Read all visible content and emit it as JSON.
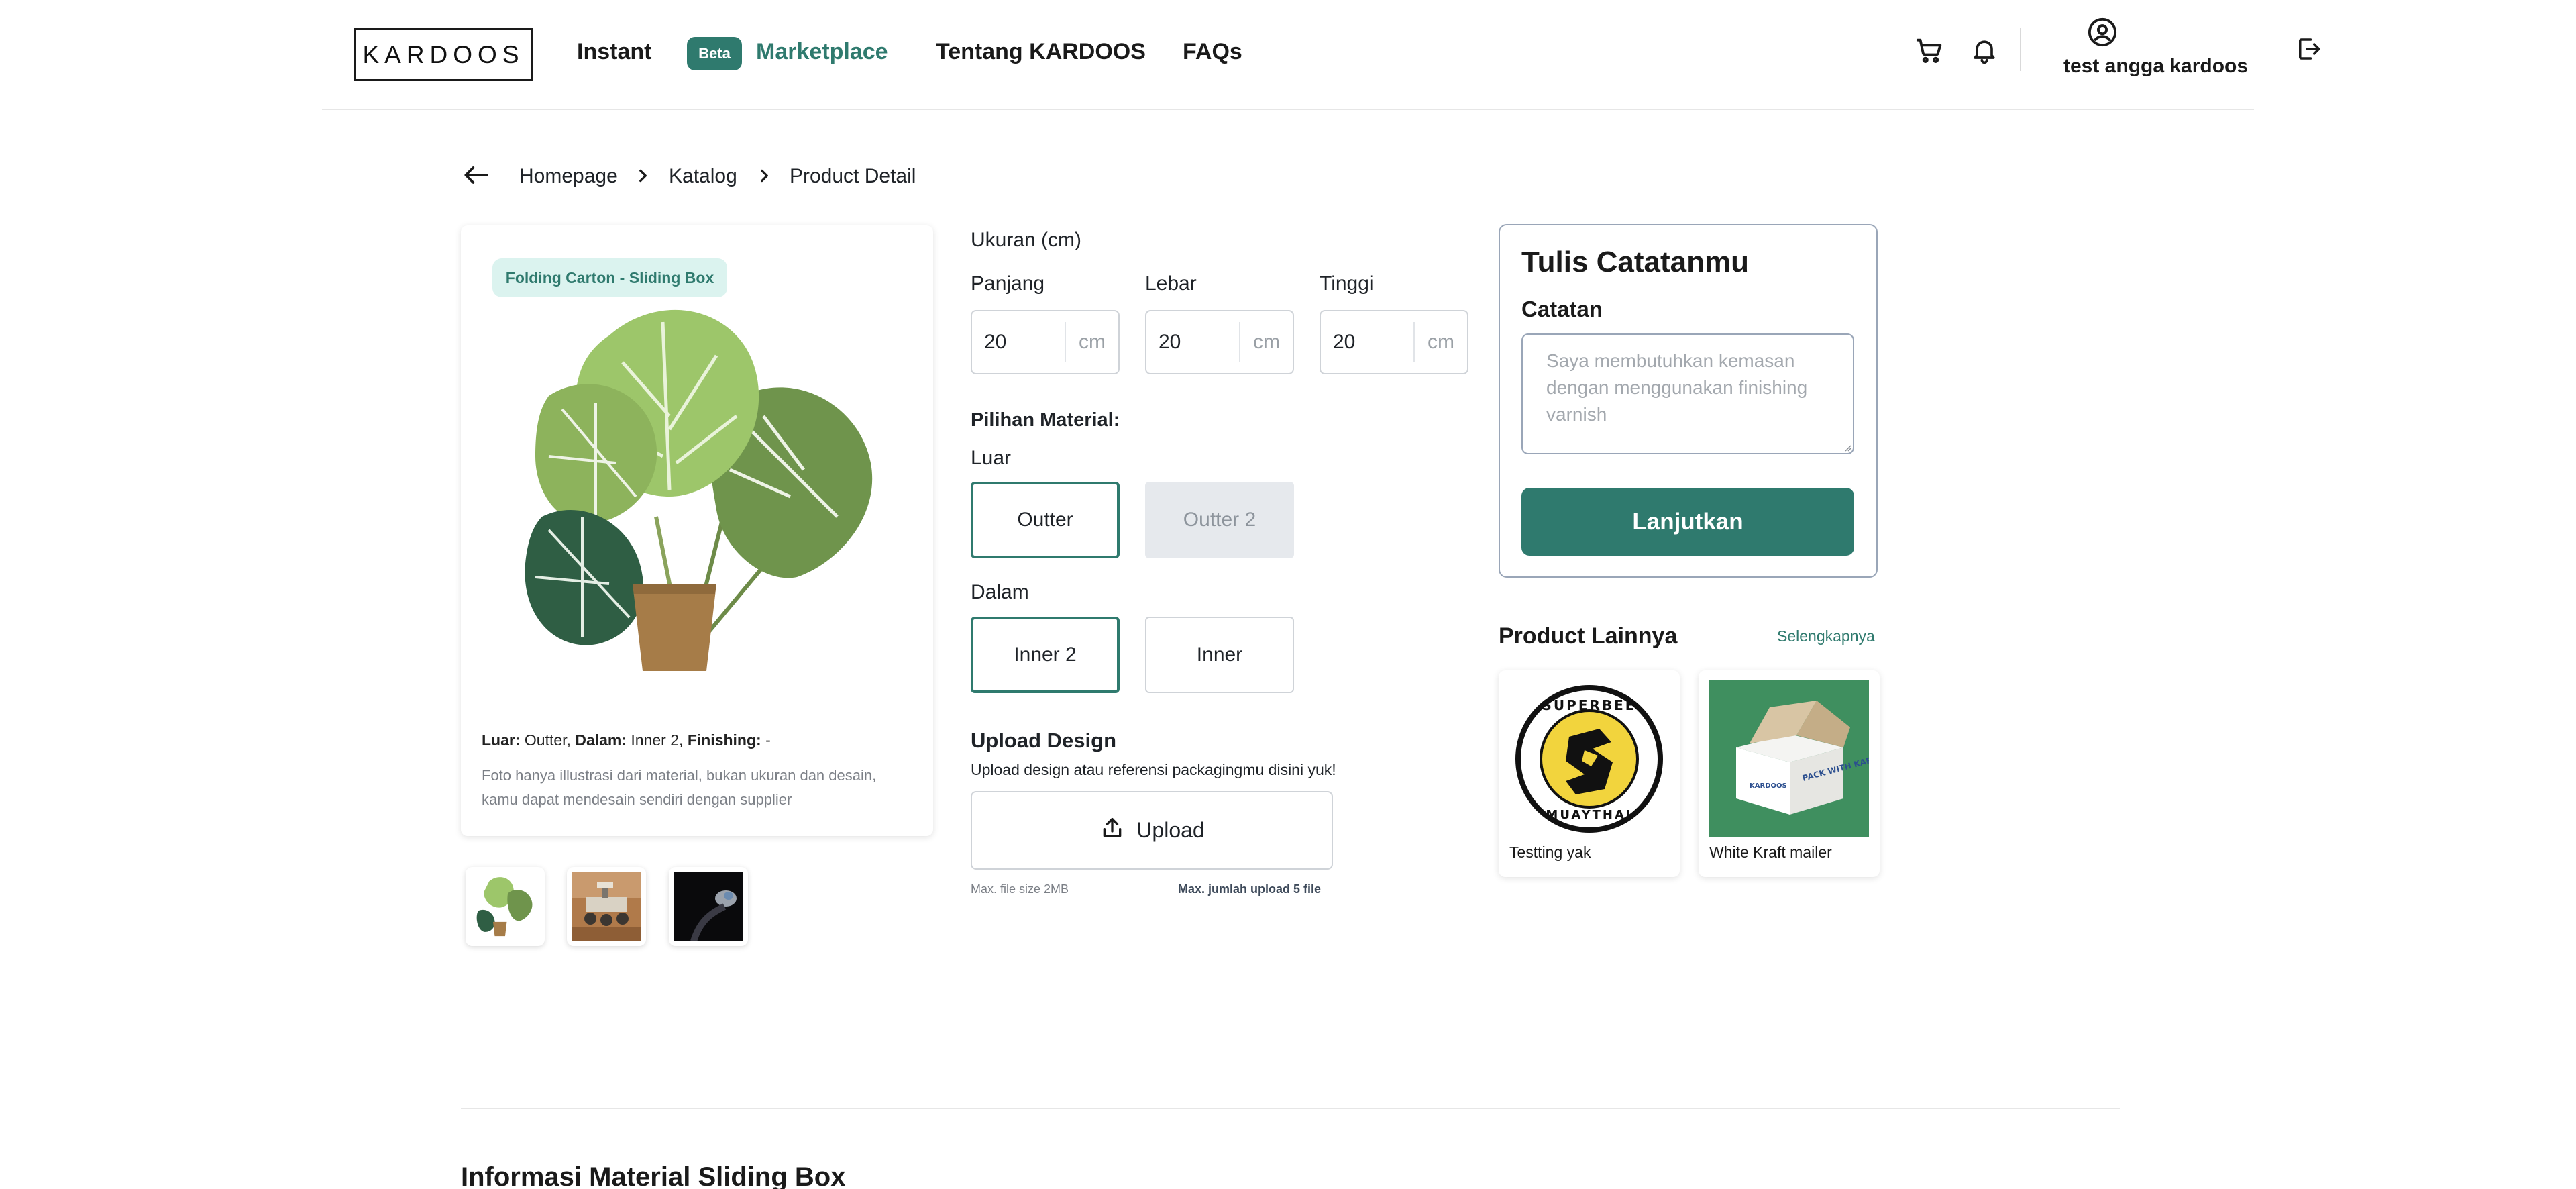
{
  "header": {
    "logo": "KARDOOS",
    "nav": {
      "instant": "Instant",
      "beta_badge": "Beta",
      "marketplace": "Marketplace",
      "about": "Tentang KARDOOS",
      "faqs": "FAQs"
    },
    "icons": [
      "cart-icon",
      "bell-icon",
      "user-circle-icon",
      "logout-icon"
    ],
    "user_name": "test angga kardoos"
  },
  "breadcrumb": {
    "items": [
      "Homepage",
      "Katalog",
      "Product Detail"
    ]
  },
  "product": {
    "type_badge": "Folding Carton - Sliding Box",
    "spec": {
      "luar_label": "Luar:",
      "luar_value": "Outter,",
      "dalam_label": "Dalam:",
      "dalam_value": "Inner 2,",
      "finishing_label": "Finishing:",
      "finishing_value": "-"
    },
    "disclaimer": "Foto hanya illustrasi dari material, bukan ukuran dan desain, kamu dapat mendesain sendiri dengan supplier",
    "thumbnails": [
      "plant-thumbnail",
      "rover-thumbnail",
      "dark-photo-thumbnail"
    ]
  },
  "size": {
    "title": "Ukuran (cm)",
    "fields": [
      {
        "label": "Panjang",
        "value": "20",
        "unit": "cm"
      },
      {
        "label": "Lebar",
        "value": "20",
        "unit": "cm"
      },
      {
        "label": "Tinggi",
        "value": "20",
        "unit": "cm"
      }
    ]
  },
  "material": {
    "title": "Pilihan Material:",
    "outer_label": "Luar",
    "outer_options": [
      "Outter",
      "Outter 2"
    ],
    "inner_label": "Dalam",
    "inner_options": [
      "Inner 2",
      "Inner"
    ]
  },
  "upload": {
    "title": "Upload Design",
    "subtitle": "Upload design atau referensi packagingmu disini yuk!",
    "button": "Upload",
    "max_size": "Max. file size 2MB",
    "max_count_prefix": "Max. jumlah upload",
    "max_count_value": "5 file"
  },
  "notes": {
    "title": "Tulis Catatanmu",
    "label": "Catatan",
    "placeholder": "Saya membutuhkan kemasan dengan menggunakan finishing varnish",
    "continue": "Lanjutkan"
  },
  "other_products": {
    "title": "Product Lainnya",
    "see_more": "Selengkapnya",
    "items": [
      {
        "name": "Testting yak",
        "image": "superbee-muaythai-logo"
      },
      {
        "name": "White Kraft mailer",
        "image": "white-box-on-green"
      }
    ],
    "logo_text_top": "SUPERBEE",
    "logo_text_bottom": "MUAYTHAI",
    "box_text": "PACK WITH KARDOOS",
    "box_brand": "KARDOOS"
  },
  "section": {
    "title": "Informasi Material Sliding Box"
  },
  "colors": {
    "primary": "#2f7a6e",
    "badge_bg": "#dbf3ef",
    "disabled_bg": "#e6e9ed",
    "border": "#cfd3d8"
  }
}
